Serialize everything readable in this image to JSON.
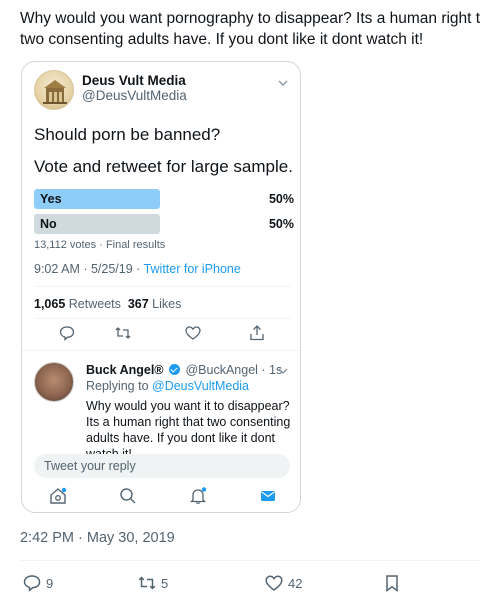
{
  "main_tweet": {
    "text_line1": "Why would you want pornography to disappear? Its a human right that",
    "text_line2": "two consenting adults have. If you dont like it dont watch it!",
    "timestamp": "2:42 PM · May 30, 2019",
    "actions": {
      "reply_count": "9",
      "retweet_count": "5",
      "like_count": "42"
    }
  },
  "quoted": {
    "name": "Deus Vult Media",
    "handle": "@DeusVultMedia",
    "body_line1": "Should porn be banned?",
    "body_line2": "Vote and retweet for large sample.",
    "poll": {
      "options": [
        {
          "label": "Yes",
          "pct": "50%",
          "value": 0.5,
          "color": "#8ecdf8"
        },
        {
          "label": "No",
          "pct": "50%",
          "value": 0.5,
          "color": "#cfd9de"
        }
      ],
      "meta": "13,112 votes · Final results"
    },
    "time": "9:02 AM · 5/25/19 · ",
    "source": "Twitter for iPhone",
    "retweets_num": "1,065",
    "retweets_label": "Retweets",
    "likes_num": "367",
    "likes_label": "Likes"
  },
  "reply": {
    "name": "Buck Angel®",
    "handle_time": "@BuckAngel · 1s",
    "replying_prefix": "Replying to ",
    "replying_to": "@DeusVultMedia",
    "text": "Why would you want it to disappear? Its a human right that two consenting adults have. If you dont like it dont watch it!"
  },
  "reply_input": {
    "placeholder": "Tweet your reply"
  },
  "colors": {
    "accent": "#1d9bf0",
    "text": "#0f1419",
    "muted": "#536471",
    "border": "#cfd9de"
  },
  "icons": [
    "chevron-down-icon",
    "reply-icon",
    "retweet-icon",
    "like-icon",
    "share-icon",
    "home-icon",
    "search-icon",
    "notifications-icon",
    "messages-icon",
    "bookmark-icon",
    "verified-icon"
  ]
}
